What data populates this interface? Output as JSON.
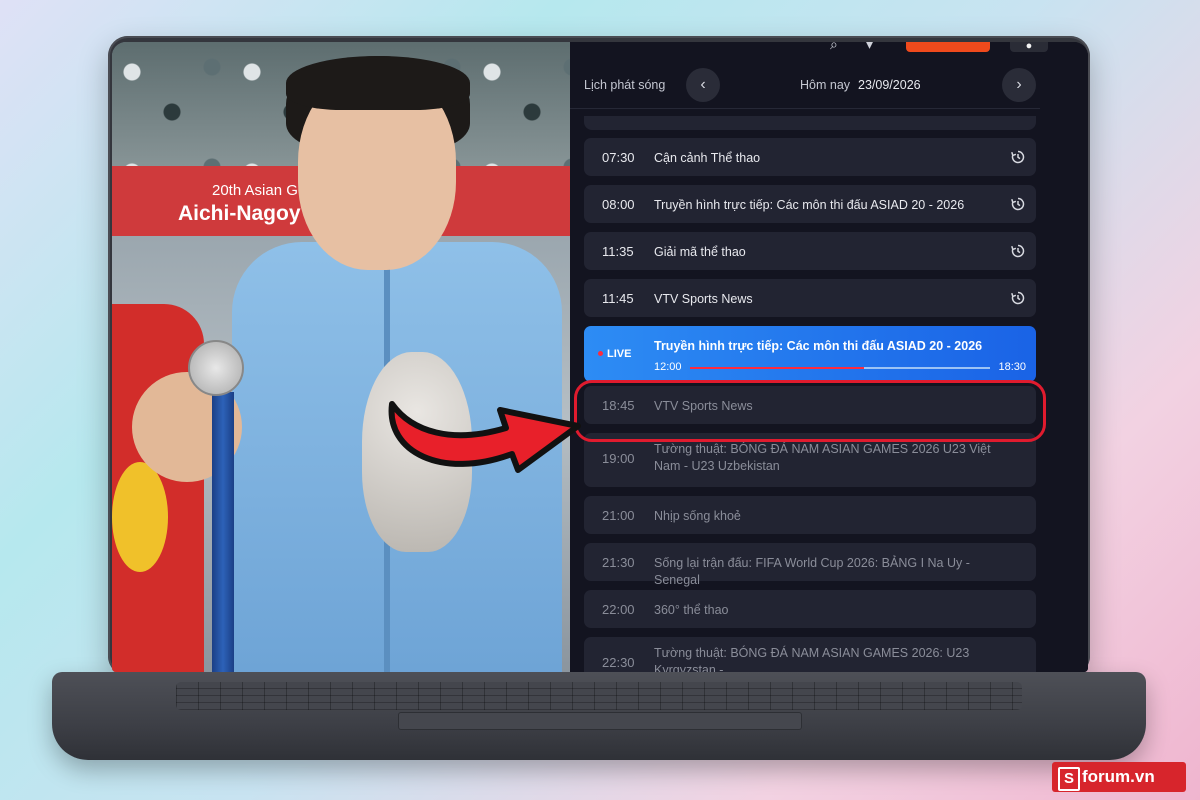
{
  "video": {
    "banner_line1": "20th Asian G",
    "banner_line2": "Aichi-Nagoy"
  },
  "schedule": {
    "label": "Lịch phát sóng",
    "prev_icon": "chevron-left-icon",
    "next_icon": "chevron-right-icon",
    "today_label": "Hôm nay",
    "date": "23/09/2026"
  },
  "programs": [
    {
      "time": "07:30",
      "title": "Cận cảnh Thể thao",
      "replay": true
    },
    {
      "time": "08:00",
      "title": "Truyền hình trực tiếp: Các môn thi đấu ASIAD 20 - 2026",
      "replay": true
    },
    {
      "time": "11:35",
      "title": "Giải mã thể thao",
      "replay": true
    },
    {
      "time": "11:45",
      "title": "VTV Sports News",
      "replay": true
    }
  ],
  "live": {
    "badge": "LIVE",
    "title": "Truyền hình trực tiếp: Các môn thi đấu ASIAD 20 - 2026",
    "start": "12:00",
    "end": "18:30",
    "progress": 0.58
  },
  "upcoming": [
    {
      "time": "18:45",
      "title": "VTV Sports News"
    },
    {
      "time": "19:00",
      "title": "Tường thuật: BÓNG ĐÁ NAM ASIAN GAMES 2026 U23 Việt Nam - U23 Uzbekistan"
    },
    {
      "time": "21:00",
      "title": "Nhịp sống khoẻ"
    },
    {
      "time": "21:30",
      "title": "Sống lại trận đấu: FIFA World Cup 2026: BẢNG I Na Uy - Senegal"
    },
    {
      "time": "22:00",
      "title": "360° thể thao"
    },
    {
      "time": "22:30",
      "title": "Tường thuật: BÓNG ĐÁ NAM ASIAN GAMES 2026: U23 Kyrgyzstan -"
    }
  ],
  "colors": {
    "live_gradient_start": "#2d8cf4",
    "live_gradient_end": "#1a63e6",
    "highlight": "#e01b2e",
    "accent_orange": "#f04a1c",
    "panel_bg": "#131420",
    "item_bg": "#222432"
  },
  "watermark": {
    "logo_letter": "S",
    "text": "forum.vn"
  }
}
